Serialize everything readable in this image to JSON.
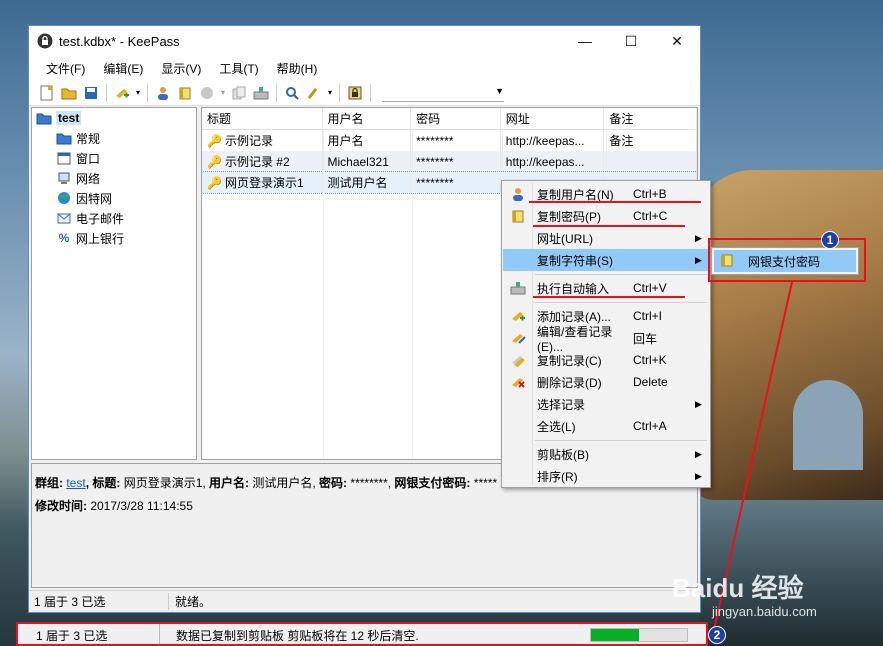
{
  "window": {
    "title": "test.kdbx* - KeePass",
    "controls": {
      "minimize": "—",
      "maximize": "☐",
      "close": "✕"
    }
  },
  "menubar": [
    "文件(F)",
    "编辑(E)",
    "显示(V)",
    "工具(T)",
    "帮助(H)"
  ],
  "tree": {
    "root": "test",
    "children": [
      "常规",
      "窗口",
      "网络",
      "因特网",
      "电子邮件",
      "网上银行"
    ]
  },
  "list": {
    "headers": [
      "标题",
      "用户名",
      "密码",
      "网址",
      "备注"
    ],
    "rows": [
      {
        "title": "示例记录",
        "user": "用户名",
        "password": "********",
        "url": "http://keepas...",
        "notes": "备注"
      },
      {
        "title": "示例记录 #2",
        "user": "Michael321",
        "password": "********",
        "url": "http://keepas...",
        "notes": ""
      },
      {
        "title": "网页登录演示1",
        "user": "测试用户名",
        "password": "********",
        "url": "",
        "notes": ""
      }
    ]
  },
  "detail": {
    "group_label": "群组:",
    "group_value": "test",
    "title_label": ", 标题:",
    "title_value": " 网页登录演示1,",
    "user_label": " 用户名:",
    "user_value": " 测试用户名,",
    "pass_label": " 密码:",
    "pass_value": " ********,",
    "bank_label": " 网银支付密码:",
    "bank_value": " *****",
    "modified_label": "修改时间:",
    "modified_value": " 2017/3/28 11:14:55"
  },
  "status": {
    "selection": "1 届于 3 已选",
    "state": "就绪。"
  },
  "context_menu": [
    {
      "label": "复制用户名(N)",
      "shortcut": "Ctrl+B",
      "icon": "user-icon"
    },
    {
      "label": "复制密码(P)",
      "shortcut": "Ctrl+C",
      "icon": "key-icon"
    },
    {
      "label": "网址(URL)",
      "shortcut": "",
      "icon": "",
      "arrow": "▶"
    },
    {
      "label": "复制字符串(S)",
      "shortcut": "",
      "icon": "",
      "arrow": "▶"
    },
    {
      "label": "执行自动输入",
      "shortcut": "Ctrl+V",
      "icon": "autotype-icon"
    },
    {
      "label": "添加记录(A)...",
      "shortcut": "Ctrl+I",
      "icon": "add-entry-icon"
    },
    {
      "label": "编辑/查看记录(E)...",
      "shortcut": "回车",
      "icon": "edit-entry-icon"
    },
    {
      "label": "复制记录(C)",
      "shortcut": "Ctrl+K",
      "icon": "duplicate-entry-icon"
    },
    {
      "label": "删除记录(D)",
      "shortcut": "Delete",
      "icon": "delete-entry-icon"
    },
    {
      "label": "选择记录",
      "shortcut": "",
      "icon": "",
      "arrow": "▶"
    },
    {
      "label": "全选(L)",
      "shortcut": "Ctrl+A",
      "icon": ""
    },
    {
      "label": "剪贴板(B)",
      "shortcut": "",
      "icon": "",
      "arrow": "▶"
    },
    {
      "label": "排序(R)",
      "shortcut": "",
      "icon": "",
      "arrow": "▶"
    }
  ],
  "submenu": {
    "label": "网银支付密码"
  },
  "badges": [
    "1",
    "2"
  ],
  "lower_status": {
    "selection": "1 届于 3 已选",
    "message": "数据已复制到剪贴板 剪贴板将在 12 秒后清空.",
    "progress": 0.5
  },
  "watermark": {
    "text": "Baidu 经验",
    "url": "jingyan.baidu.com"
  },
  "colors": {
    "highlight": "#91c9f7",
    "annotation_red": "#e8101a",
    "progress_green": "#06b025"
  }
}
